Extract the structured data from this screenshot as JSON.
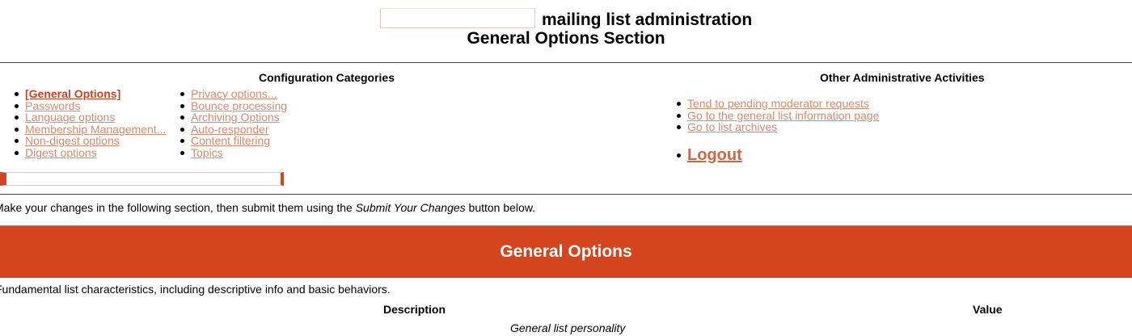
{
  "header": {
    "list_name_field": "",
    "admin_title": "mailing list administration",
    "section_title": "General Options Section"
  },
  "config": {
    "heading": "Configuration Categories",
    "column1": [
      {
        "label": "[General Options]",
        "current": true
      },
      {
        "label": "Passwords"
      },
      {
        "label": "Language options"
      },
      {
        "label": "Membership Management..."
      },
      {
        "label": "Non-digest options"
      },
      {
        "label": "Digest options"
      }
    ],
    "column2": [
      {
        "label": "Privacy options..."
      },
      {
        "label": "Bounce processing"
      },
      {
        "label": "Archiving Options"
      },
      {
        "label": "Auto-responder"
      },
      {
        "label": "Content filtering"
      },
      {
        "label": "Topics"
      }
    ]
  },
  "other": {
    "heading": "Other Administrative Activities",
    "items": [
      {
        "label": "Tend to pending moderator requests"
      },
      {
        "label": "Go to the general list information page"
      },
      {
        "label": "Go to list archives"
      }
    ],
    "logout": "Logout"
  },
  "instructions": {
    "before": "Make your changes in the following section, then submit them using the ",
    "emphasis": "Submit Your Changes",
    "after": " button below."
  },
  "banner": {
    "title": "General Options",
    "color": "#d4451f"
  },
  "section": {
    "description": "Fundamental list characteristics, including descriptive info and basic behaviors.",
    "col_description": "Description",
    "col_value": "Value",
    "subsection": "General list personality"
  },
  "colors": {
    "link": "#d88a6e",
    "current_link": "#c9431f",
    "accent": "#d4451f"
  }
}
